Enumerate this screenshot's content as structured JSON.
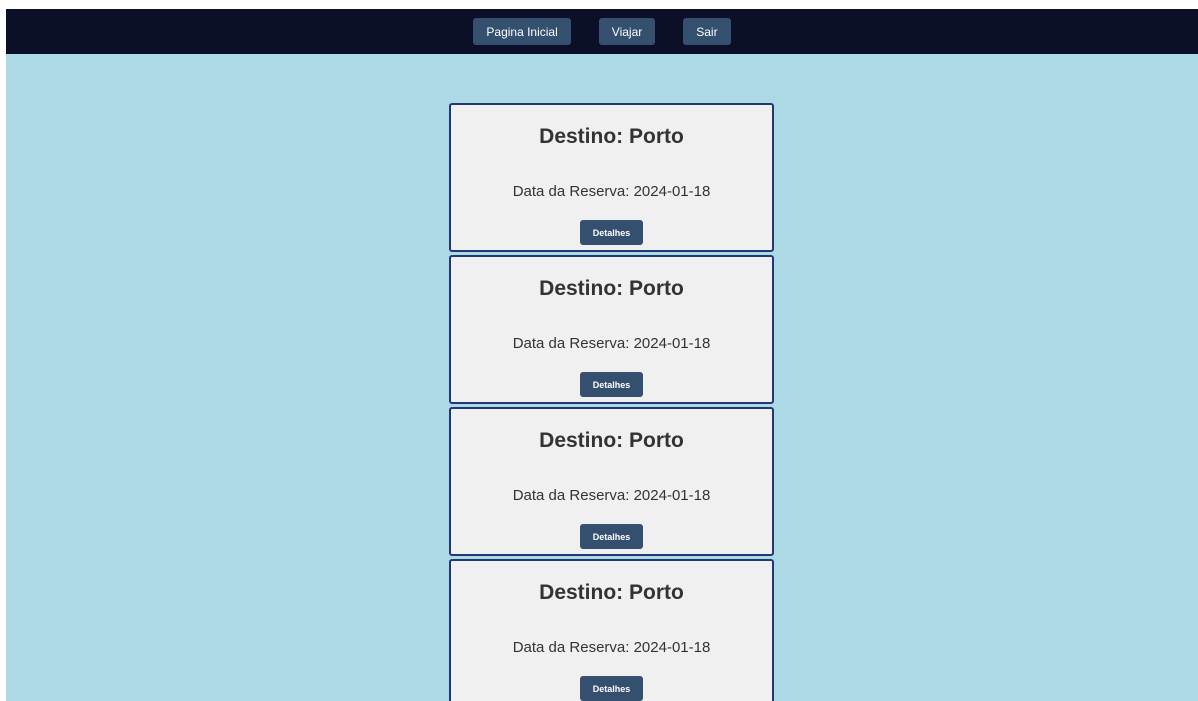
{
  "nav": {
    "items": [
      {
        "label": "Pagina Inicial"
      },
      {
        "label": "Viajar"
      },
      {
        "label": "Sair"
      }
    ]
  },
  "reservations": [
    {
      "destination": "Destino: Porto",
      "date": "Data da Reserva: 2024-01-18",
      "button": "Detalhes"
    },
    {
      "destination": "Destino: Porto",
      "date": "Data da Reserva: 2024-01-18",
      "button": "Detalhes"
    },
    {
      "destination": "Destino: Porto",
      "date": "Data da Reserva: 2024-01-18",
      "button": "Detalhes"
    },
    {
      "destination": "Destino: Porto",
      "date": "Data da Reserva: 2024-01-18",
      "button": "Detalhes"
    }
  ],
  "colors": {
    "navbar_bg": "#0b0f27",
    "page_bg": "#add8e6",
    "button_bg": "#34506e",
    "card_bg": "#f0f0f0",
    "card_border": "#1f3a73"
  }
}
